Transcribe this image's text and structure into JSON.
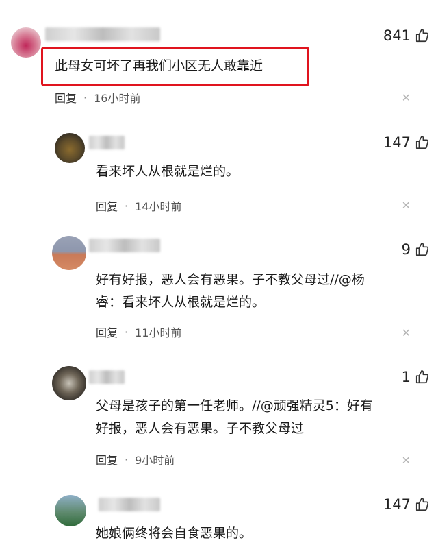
{
  "comments": [
    {
      "likes": "841",
      "text": "此母女可坏了再我们小区无人敢靠近",
      "reply": "回复",
      "time": "16小时前"
    },
    {
      "likes": "147",
      "text": "看来坏人从根就是烂的。",
      "reply": "回复",
      "time": "14小时前"
    },
    {
      "likes": "9",
      "text": "好有好报，恶人会有恶果。子不教父母过//@杨\n睿：看来坏人从根就是烂的。",
      "reply": "回复",
      "time": "11小时前"
    },
    {
      "likes": "1",
      "text": "父母是孩子的第一任老师。//@顽强精灵5：好有\n好报，恶人会有恶果。子不教父母过",
      "reply": "回复",
      "time": "9小时前"
    },
    {
      "likes": "147",
      "text": "她娘俩终将会自食恶果的。"
    }
  ],
  "icons": {
    "like": "thumbs-up-icon",
    "close": "close-icon"
  },
  "colors": {
    "highlight": "#e0141e",
    "meta_text": "#555555"
  }
}
